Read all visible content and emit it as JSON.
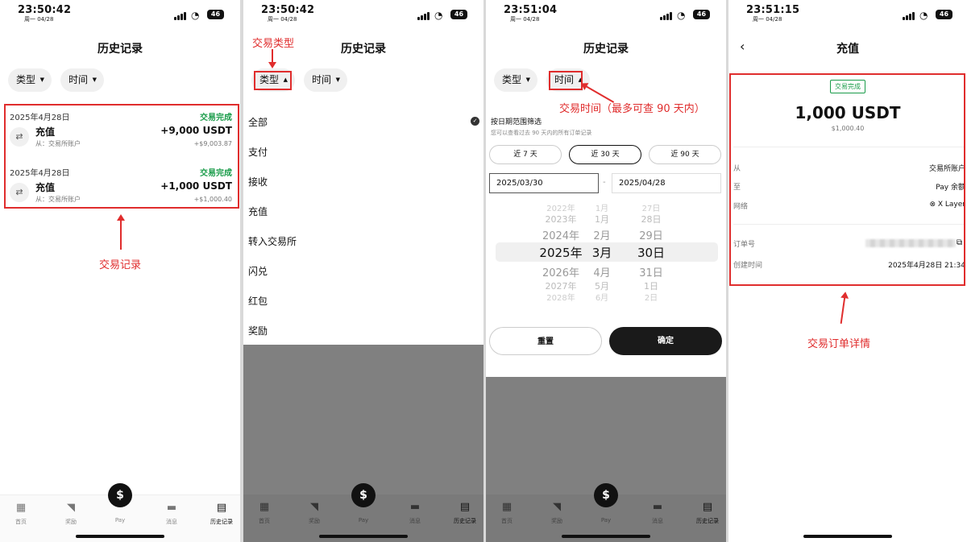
{
  "screens": [
    {
      "time": "23:50:42",
      "date": "周一 04/28",
      "battery": "46"
    },
    {
      "time": "23:50:42",
      "date": "周一 04/28",
      "battery": "46"
    },
    {
      "time": "23:51:04",
      "date": "周一 04/28",
      "battery": "46"
    },
    {
      "time": "23:51:15",
      "date": "周一 04/28",
      "battery": "46"
    }
  ],
  "history": {
    "title": "历史记录",
    "filter_type": "类型",
    "filter_time": "时间",
    "records": [
      {
        "date": "2025年4月28日",
        "status": "交易完成",
        "title": "充值",
        "from": "从：交易所账户",
        "amount": "+9,000 USDT",
        "fiat": "+$9,003.87"
      },
      {
        "date": "2025年4月28日",
        "status": "交易完成",
        "title": "充值",
        "from": "从：交易所账户",
        "amount": "+1,000 USDT",
        "fiat": "+$1,000.40"
      }
    ]
  },
  "type_menu": [
    "全部",
    "支付",
    "接收",
    "充值",
    "转入交易所",
    "闪兑",
    "红包",
    "奖励"
  ],
  "time_sheet": {
    "title": "按日期范围筛选",
    "subtitle": "您可以查看过去 90 天内的所有订单记录",
    "ranges": [
      "近 7 天",
      "近 30 天",
      "近 90 天"
    ],
    "start": "2025/03/30",
    "end": "2025/04/28",
    "picker": {
      "years": [
        "2022 年",
        "2023 年",
        "2024 年",
        "2025 年",
        "2026 年",
        "2027 年",
        "2028 年"
      ],
      "months": [
        "1 月",
        "1 月",
        "2 月",
        "3 月",
        "4 月",
        "5 月",
        "6 月"
      ],
      "days": [
        "27 日",
        "28 日",
        "29 日",
        "30 日",
        "31 日",
        "1 日",
        "2 日"
      ],
      "years_text": [
        "2022 年",
        "2023 年",
        "2024 年",
        "2025 年",
        "2026 年",
        "2027 年",
        "2028 年"
      ]
    },
    "picker_display": {
      "years": [
        "2022年",
        "2023年",
        "2024年",
        "2025年",
        "2026年",
        "2027年",
        "2028年"
      ],
      "months": [
        "1月",
        "1月",
        "2月",
        "3月",
        "4月",
        "5月",
        "6月"
      ],
      "days": [
        "27日",
        "28日",
        "29日",
        "30日",
        "31日",
        "1日",
        "2日"
      ]
    },
    "reset": "重置",
    "confirm": "确定"
  },
  "detail": {
    "title": "充值",
    "status": "交易完成",
    "amount": "1,000 USDT",
    "fiat": "$1,000.40",
    "rows": [
      {
        "label": "从",
        "value": "交易所账户"
      },
      {
        "label": "至",
        "value": "Pay 余额"
      },
      {
        "label": "网络",
        "value": "X Layer"
      },
      {
        "label": "订单号",
        "value": ""
      },
      {
        "label": "创建时间",
        "value": "2025年4月28日 21:34"
      }
    ]
  },
  "annotations": {
    "records": "交易记录",
    "type": "交易类型",
    "time": "交易时间（最多可查 90 天内）",
    "detail": "交易订单详情"
  },
  "tabs": [
    "首页",
    "奖励",
    "Pay",
    "消息",
    "历史记录"
  ],
  "colors": {
    "annotation": "#e02d2d",
    "success": "#1a9c4a",
    "overlay": "#808080"
  }
}
